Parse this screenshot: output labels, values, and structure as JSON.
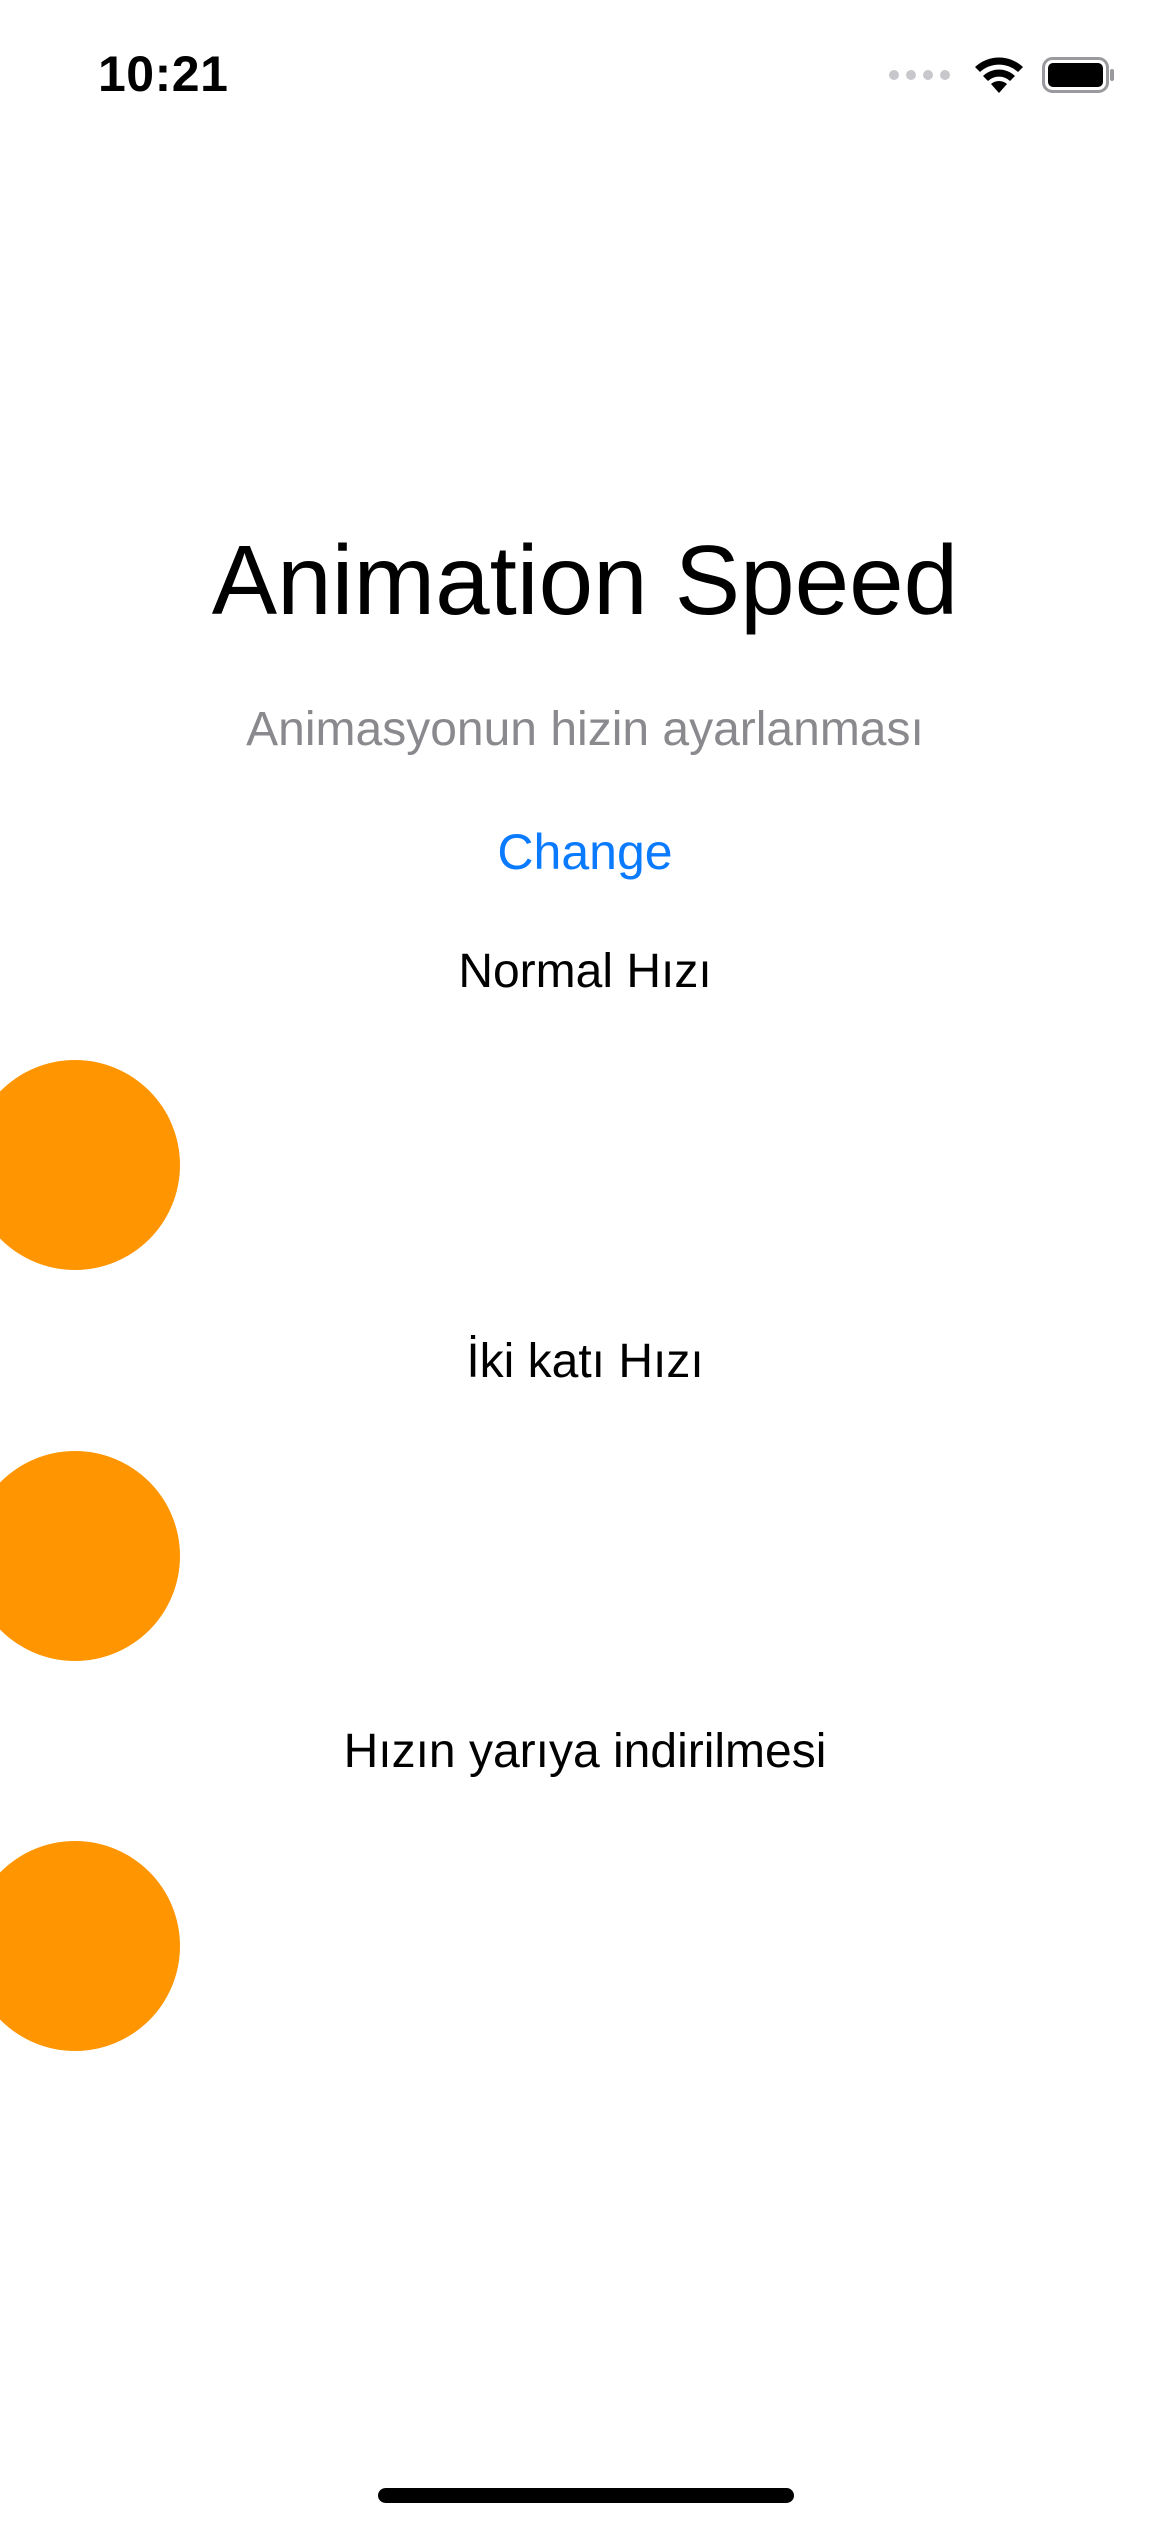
{
  "status_bar": {
    "time": "10:21",
    "signal_icon": "signal-dots-icon",
    "wifi_icon": "wifi-icon",
    "battery_icon": "battery-full-icon"
  },
  "main": {
    "title": "Animation Speed",
    "subtitle": "Animasyonun hizin ayarlanması",
    "change_button_label": "Change",
    "rows": [
      {
        "label": "Normal Hızı",
        "ball_color": "#ff9500"
      },
      {
        "label": "İki katı Hızı",
        "ball_color": "#ff9500"
      },
      {
        "label": "Hızın yarıya indirilmesi",
        "ball_color": "#ff9500"
      }
    ]
  },
  "colors": {
    "accent": "#0a7aff",
    "ball": "#ff9500",
    "subtitle": "#8a8a8e",
    "text": "#000000",
    "background": "#ffffff"
  }
}
